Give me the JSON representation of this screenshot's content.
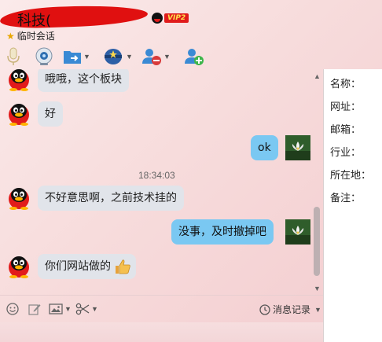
{
  "window": {
    "title": "科技(",
    "vip_label": "VIP2",
    "subtitle": "临时会话"
  },
  "toolbar": {
    "items": [
      "microphone-icon",
      "video-camera-icon",
      "file-transfer-icon",
      "app-center-icon",
      "remove-contact-icon",
      "add-contact-icon"
    ]
  },
  "chat": {
    "messages": [
      {
        "dir": "in",
        "text": "哦哦，这个板块"
      },
      {
        "dir": "in",
        "text": "好"
      },
      {
        "dir": "out",
        "text": "ok"
      },
      {
        "dir": "in",
        "text": "不好意思啊，之前技术挂的"
      },
      {
        "dir": "out",
        "text": "没事，及时撤掉吧"
      },
      {
        "dir": "in",
        "text": "你们网站做的"
      }
    ],
    "timestamp": "18:34:03"
  },
  "input_toolbar": {
    "history_label": "消息记录"
  },
  "info_panel": {
    "fields": [
      "名称：",
      "网址：",
      "邮箱：",
      "行业：",
      "所在地：",
      "备注："
    ]
  },
  "colors": {
    "incoming_bubble": "#e1e4ea",
    "outgoing_bubble": "#7ac8f2",
    "vip_red": "#e01b1b"
  }
}
